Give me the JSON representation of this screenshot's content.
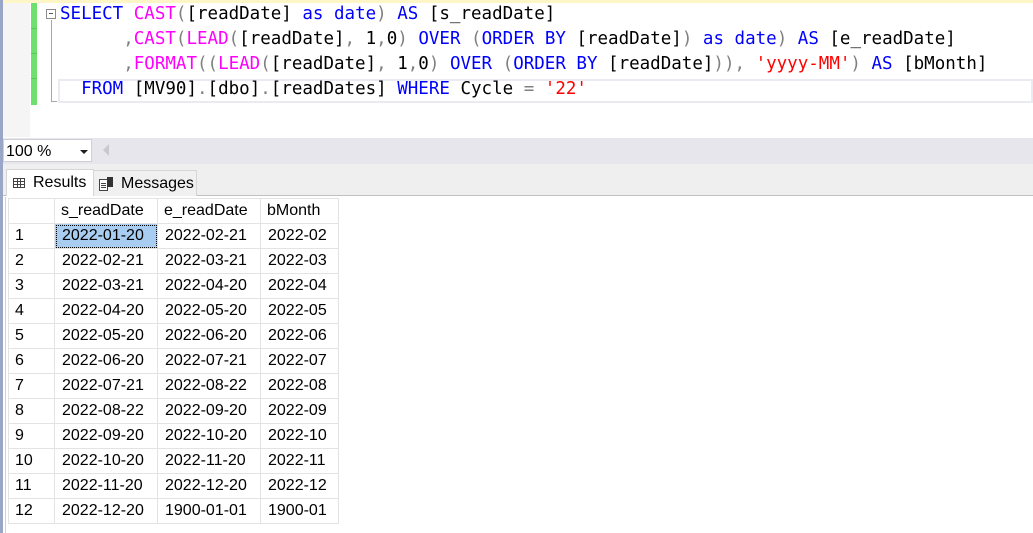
{
  "editor": {
    "lines": [
      [
        {
          "t": "SELECT",
          "c": "kw"
        },
        {
          "t": " ",
          "c": "tx"
        },
        {
          "t": "CAST",
          "c": "fn"
        },
        {
          "t": "(",
          "c": "op"
        },
        {
          "t": "[readDate]",
          "c": "tx"
        },
        {
          "t": " ",
          "c": "tx"
        },
        {
          "t": "as",
          "c": "kw"
        },
        {
          "t": " ",
          "c": "tx"
        },
        {
          "t": "date",
          "c": "kw"
        },
        {
          "t": ")",
          "c": "op"
        },
        {
          "t": " ",
          "c": "tx"
        },
        {
          "t": "AS",
          "c": "kw"
        },
        {
          "t": " [s_readDate]",
          "c": "tx"
        }
      ],
      [
        {
          "t": "      ",
          "c": "tx"
        },
        {
          "t": ",",
          "c": "op"
        },
        {
          "t": "CAST",
          "c": "fn"
        },
        {
          "t": "(",
          "c": "op"
        },
        {
          "t": "LEAD",
          "c": "fn"
        },
        {
          "t": "(",
          "c": "op"
        },
        {
          "t": "[readDate]",
          "c": "tx"
        },
        {
          "t": ",",
          "c": "op"
        },
        {
          "t": " 1",
          "c": "tx"
        },
        {
          "t": ",",
          "c": "op"
        },
        {
          "t": "0",
          "c": "tx"
        },
        {
          "t": ")",
          "c": "op"
        },
        {
          "t": " ",
          "c": "tx"
        },
        {
          "t": "OVER",
          "c": "kw"
        },
        {
          "t": " ",
          "c": "tx"
        },
        {
          "t": "(",
          "c": "op"
        },
        {
          "t": "ORDER",
          "c": "kw"
        },
        {
          "t": " ",
          "c": "tx"
        },
        {
          "t": "BY",
          "c": "kw"
        },
        {
          "t": " [readDate]",
          "c": "tx"
        },
        {
          "t": ")",
          "c": "op"
        },
        {
          "t": " ",
          "c": "tx"
        },
        {
          "t": "as",
          "c": "kw"
        },
        {
          "t": " ",
          "c": "tx"
        },
        {
          "t": "date",
          "c": "kw"
        },
        {
          "t": ")",
          "c": "op"
        },
        {
          "t": " ",
          "c": "tx"
        },
        {
          "t": "AS",
          "c": "kw"
        },
        {
          "t": " [e_readDate]",
          "c": "tx"
        }
      ],
      [
        {
          "t": "      ",
          "c": "tx"
        },
        {
          "t": ",",
          "c": "op"
        },
        {
          "t": "FORMAT",
          "c": "fn"
        },
        {
          "t": "((",
          "c": "op"
        },
        {
          "t": "LEAD",
          "c": "fn"
        },
        {
          "t": "(",
          "c": "op"
        },
        {
          "t": "[readDate]",
          "c": "tx"
        },
        {
          "t": ",",
          "c": "op"
        },
        {
          "t": " 1",
          "c": "tx"
        },
        {
          "t": ",",
          "c": "op"
        },
        {
          "t": "0",
          "c": "tx"
        },
        {
          "t": ")",
          "c": "op"
        },
        {
          "t": " ",
          "c": "tx"
        },
        {
          "t": "OVER",
          "c": "kw"
        },
        {
          "t": " ",
          "c": "tx"
        },
        {
          "t": "(",
          "c": "op"
        },
        {
          "t": "ORDER",
          "c": "kw"
        },
        {
          "t": " ",
          "c": "tx"
        },
        {
          "t": "BY",
          "c": "kw"
        },
        {
          "t": " [readDate]",
          "c": "tx"
        },
        {
          "t": ")),",
          "c": "op"
        },
        {
          "t": " ",
          "c": "tx"
        },
        {
          "t": "'yyyy-MM'",
          "c": "str"
        },
        {
          "t": ")",
          "c": "op"
        },
        {
          "t": " ",
          "c": "tx"
        },
        {
          "t": "AS",
          "c": "kw"
        },
        {
          "t": " [bMonth]",
          "c": "tx"
        }
      ],
      [
        {
          "t": "  ",
          "c": "tx"
        },
        {
          "t": "FROM",
          "c": "kw"
        },
        {
          "t": " [MV90]",
          "c": "tx"
        },
        {
          "t": ".",
          "c": "op"
        },
        {
          "t": "[dbo]",
          "c": "tx"
        },
        {
          "t": ".",
          "c": "op"
        },
        {
          "t": "[readDates]",
          "c": "tx"
        },
        {
          "t": " ",
          "c": "tx"
        },
        {
          "t": "WHERE",
          "c": "kw"
        },
        {
          "t": " Cycle ",
          "c": "tx"
        },
        {
          "t": "=",
          "c": "op"
        },
        {
          "t": " ",
          "c": "tx"
        },
        {
          "t": "'22'",
          "c": "str"
        }
      ]
    ]
  },
  "zoom": {
    "value": "100 %"
  },
  "tabs": {
    "results": "Results",
    "messages": "Messages"
  },
  "results": {
    "columns": [
      "",
      "s_readDate",
      "e_readDate",
      "bMonth"
    ],
    "rows": [
      [
        "1",
        "2022-01-20",
        "2022-02-21",
        "2022-02"
      ],
      [
        "2",
        "2022-02-21",
        "2022-03-21",
        "2022-03"
      ],
      [
        "3",
        "2022-03-21",
        "2022-04-20",
        "2022-04"
      ],
      [
        "4",
        "2022-04-20",
        "2022-05-20",
        "2022-05"
      ],
      [
        "5",
        "2022-05-20",
        "2022-06-20",
        "2022-06"
      ],
      [
        "6",
        "2022-06-20",
        "2022-07-21",
        "2022-07"
      ],
      [
        "7",
        "2022-07-21",
        "2022-08-22",
        "2022-08"
      ],
      [
        "8",
        "2022-08-22",
        "2022-09-20",
        "2022-09"
      ],
      [
        "9",
        "2022-09-20",
        "2022-10-20",
        "2022-10"
      ],
      [
        "10",
        "2022-10-20",
        "2022-11-20",
        "2022-11"
      ],
      [
        "11",
        "2022-11-20",
        "2022-12-20",
        "2022-12"
      ],
      [
        "12",
        "2022-12-20",
        "1900-01-01",
        "1900-01"
      ]
    ],
    "selected_cell": {
      "row": 0,
      "col": 1
    }
  },
  "colors": {
    "keyword": "#0000ff",
    "function": "#ff00ff",
    "string": "#ff0000",
    "operator": "#808080",
    "change_bar": "#6ee06e",
    "selection": "#a8cdf0"
  }
}
